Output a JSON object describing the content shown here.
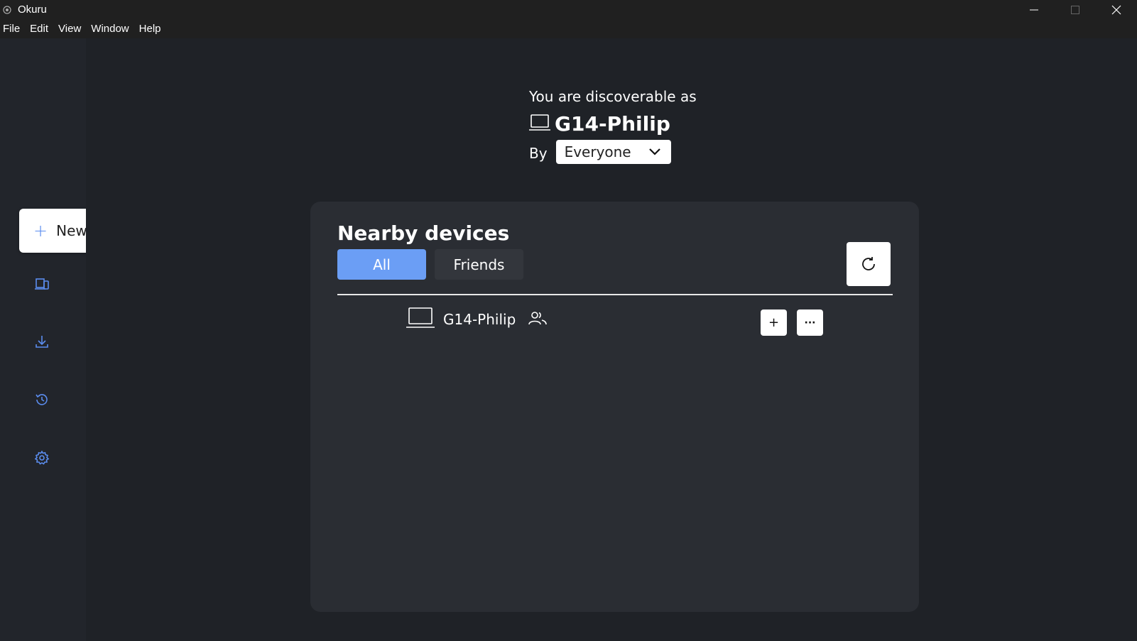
{
  "window": {
    "title": "Okuru"
  },
  "menu": {
    "items": [
      "File",
      "Edit",
      "View",
      "Window",
      "Help"
    ]
  },
  "sidebar": {
    "new_label": "New",
    "icons": [
      "devices-icon",
      "download-icon",
      "history-icon",
      "settings-icon"
    ]
  },
  "discover": {
    "heading": "You are discoverable as",
    "device_name": "G14-Philip",
    "by_label": "By",
    "visibility_value": "Everyone"
  },
  "nearby": {
    "title": "Nearby devices",
    "tabs": [
      "All",
      "Friends"
    ],
    "active_tab": "All",
    "devices": [
      {
        "name": "G14-Philip",
        "icon": "laptop-icon",
        "status_icon": "friends-icon"
      }
    ],
    "add_label": "+",
    "more_label": "···"
  },
  "colors": {
    "accent": "#6b9ef5",
    "icon_blue": "#5b8def",
    "background": "#1f2227",
    "panel": "#2a2d33"
  }
}
